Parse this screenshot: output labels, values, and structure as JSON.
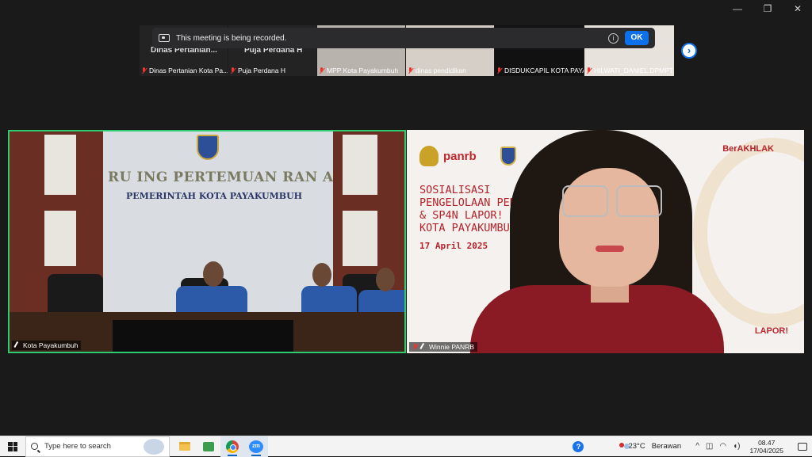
{
  "window": {
    "minimize": "—",
    "maximize": "❐",
    "close": "✕"
  },
  "banner": {
    "text": "This meeting is being recorded.",
    "info": "i",
    "ok": "OK"
  },
  "thumbnails": [
    {
      "display_name": "Dinas  Pertanian...",
      "label": "Dinas Pertanian Kota Pa..."
    },
    {
      "display_name": "Puja Perdana H",
      "label": "Puja Perdana H"
    },
    {
      "display_name": "",
      "label": "MPP Kota Payakumbuh"
    },
    {
      "display_name": "",
      "label": "dinas pendidikan"
    },
    {
      "display_name": "",
      "label": "DISDUKCAPIL KOTA PAYA..."
    },
    {
      "display_name": "",
      "label": "HILWATI_DANIEL DPMPT..."
    }
  ],
  "next_arrow": "›",
  "tiles": {
    "left": {
      "name": "Kota Payakumbuh",
      "wall_title": "RU ING PERTEMUAN RAN ANG",
      "wall_subtitle": "PEMERINTAH KOTA PAYAKUMBUH"
    },
    "right": {
      "name": "Winnie PANRB",
      "logo_text": "panrb",
      "berakhlak": "BerAKHLAK",
      "slide_line1": "SOSIALISASI",
      "slide_line2": "PENGELOLAAN PENGA",
      "slide_line3": "& SP4N LAPOR!",
      "slide_line4": "KOTA PAYAKUMBUH",
      "slide_date": "17 April 2025",
      "lapor": "LAPOR!"
    }
  },
  "taskbar": {
    "search_placeholder": "Type here to search",
    "zoom_label": "zm",
    "help": "?",
    "weather_temp": "23°C",
    "weather_desc": "Berawan",
    "chevron": "^",
    "time": "08.47",
    "date": "17/04/2025"
  }
}
